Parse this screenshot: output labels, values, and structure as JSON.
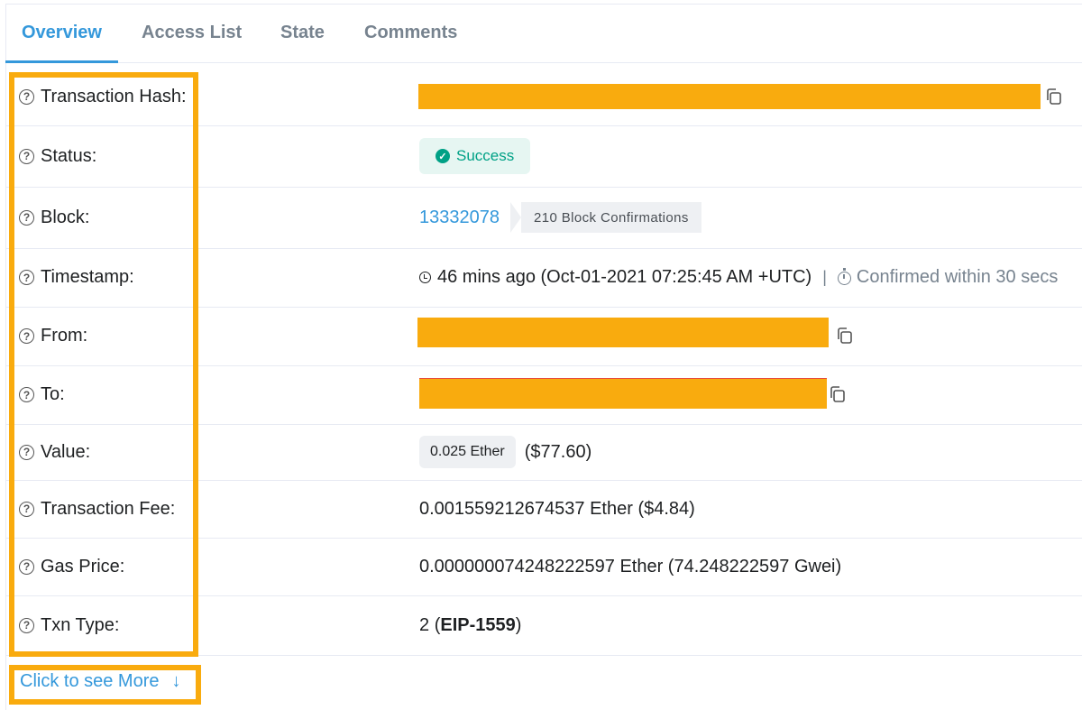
{
  "tabs": [
    {
      "label": "Overview",
      "active": true
    },
    {
      "label": "Access List",
      "active": false
    },
    {
      "label": "State",
      "active": false
    },
    {
      "label": "Comments",
      "active": false
    }
  ],
  "rows": {
    "tx_hash": {
      "label": "Transaction Hash:"
    },
    "status": {
      "label": "Status:",
      "value": "Success"
    },
    "block": {
      "label": "Block:",
      "number": "13332078",
      "confirmations": "210 Block Confirmations"
    },
    "timestamp": {
      "label": "Timestamp:",
      "value": "46 mins ago (Oct-01-2021 07:25:45 AM +UTC)",
      "separator": "|",
      "confirmed": "Confirmed within 30 secs"
    },
    "from": {
      "label": "From:"
    },
    "to": {
      "label": "To:"
    },
    "value": {
      "label": "Value:",
      "amount": "0.025 Ether",
      "usd": "($77.60)"
    },
    "fee": {
      "label": "Transaction Fee:",
      "value": "0.001559212674537 Ether ($4.84)"
    },
    "gas_price": {
      "label": "Gas Price:",
      "value": "0.000000074248222597 Ether (74.248222597 Gwei)"
    },
    "txn_type": {
      "label": "Txn Type:",
      "number": "2",
      "open": "(",
      "type": "EIP-1559",
      "close": ")"
    }
  },
  "more_link": {
    "label": "Click to see More",
    "arrow": "↓"
  },
  "colors": {
    "accent": "#3498db",
    "success": "#00a186",
    "highlight": "#f9ab0e",
    "muted": "#77838f"
  },
  "icons": [
    "question-icon",
    "copy-icon",
    "check-icon",
    "clock-icon",
    "timer-icon",
    "arrow-down-icon"
  ]
}
